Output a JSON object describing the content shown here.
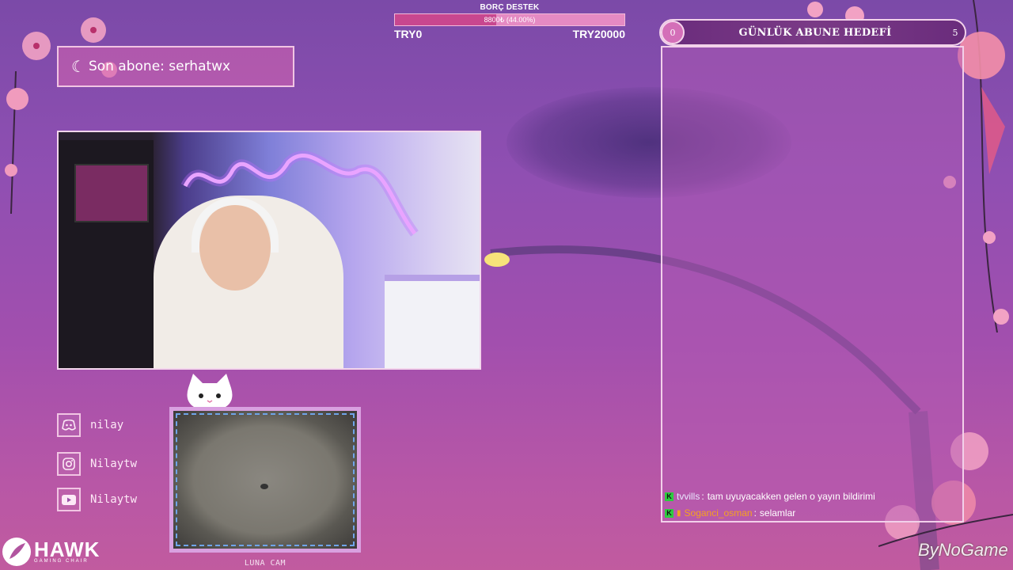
{
  "donation": {
    "title": "BORÇ DESTEK",
    "bar_text": "8800₺ (44.00%)",
    "progress_fraction": 0.44,
    "min_label": "TRY0",
    "max_label": "TRY20000"
  },
  "last_sub": {
    "text": "Son abone: serhatwx"
  },
  "socials": [
    {
      "icon": "discord-icon",
      "handle": "nilay"
    },
    {
      "icon": "instagram-icon",
      "handle": "Nilaytw"
    },
    {
      "icon": "youtube-icon",
      "handle": "Nilaytw"
    }
  ],
  "cat_cam": {
    "label": "LUNA CAM"
  },
  "sub_goal": {
    "title": "GÜNLÜK ABUNE HEDEFİ",
    "current": "0",
    "target": "5"
  },
  "chat": [
    {
      "badge": "K",
      "user": "tvvills",
      "message": "tam uyuyacakken gelen o yayın bildirimi"
    },
    {
      "badge": "K",
      "user": "Soganci_osman",
      "message": "selamlar"
    }
  ],
  "brand": {
    "hawk": "HAWK",
    "hawk_sub": "GAMING CHAIR",
    "bynogame": "ByNoGame"
  },
  "colors": {
    "accent_pink": "#c8478f",
    "panel_border": "#f2d0ea",
    "chat_badge": "#2ecc40",
    "chat_user_highlight": "#f6a21e"
  }
}
